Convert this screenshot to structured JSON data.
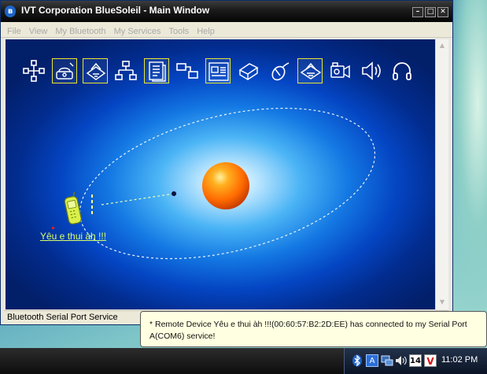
{
  "window": {
    "title": "IVT Corporation BlueSoleil - Main Window",
    "title_icon": "bluetooth-icon",
    "controls": [
      "minimize",
      "maximize",
      "close"
    ]
  },
  "menu": {
    "items": [
      "File",
      "View",
      "My Bluetooth",
      "My Services",
      "Tools",
      "Help"
    ]
  },
  "service_icons": [
    {
      "name": "personal-area-network-icon",
      "active": false
    },
    {
      "name": "dial-up-networking-icon",
      "active": true
    },
    {
      "name": "fax-icon",
      "active": true
    },
    {
      "name": "lan-access-icon",
      "active": false
    },
    {
      "name": "file-transfer-icon",
      "active": true
    },
    {
      "name": "synchronization-icon",
      "active": false
    },
    {
      "name": "serial-port-icon",
      "active": true
    },
    {
      "name": "printer-icon",
      "active": false
    },
    {
      "name": "mouse-icon",
      "active": false
    },
    {
      "name": "fax-machine-icon",
      "active": true
    },
    {
      "name": "camera-icon",
      "active": false
    },
    {
      "name": "speaker-icon",
      "active": false
    },
    {
      "name": "headset-icon",
      "active": false
    }
  ],
  "device": {
    "label": "Yêu e thui àh !!!",
    "icon": "mobile-phone-icon"
  },
  "status": {
    "text": "Bluetooth Serial Port Service"
  },
  "notification": {
    "text": "* Remote Device Yêu e thui àh !!!(00:60:57:B2:2D:EE)  has connected to my  Serial Port A(COM6) service!"
  },
  "taskbar": {
    "tray_icons": [
      "bluetooth-icon",
      "language-icon",
      "network-icon",
      "volume-icon",
      "calendar-icon",
      "antivirus-icon"
    ],
    "calendar_day": "14",
    "antivirus_letter": "V",
    "language_letter": "A",
    "clock": "11:02 PM"
  },
  "colors": {
    "title_bar": "#111111",
    "canvas_dark": "#022c8e",
    "canvas_light": "#4ab4f5",
    "orbit": "#e9f4ff",
    "device_label": "#d8ff6a",
    "icon_highlight": "#e8e830",
    "balloon_bg": "#ffffe1"
  }
}
